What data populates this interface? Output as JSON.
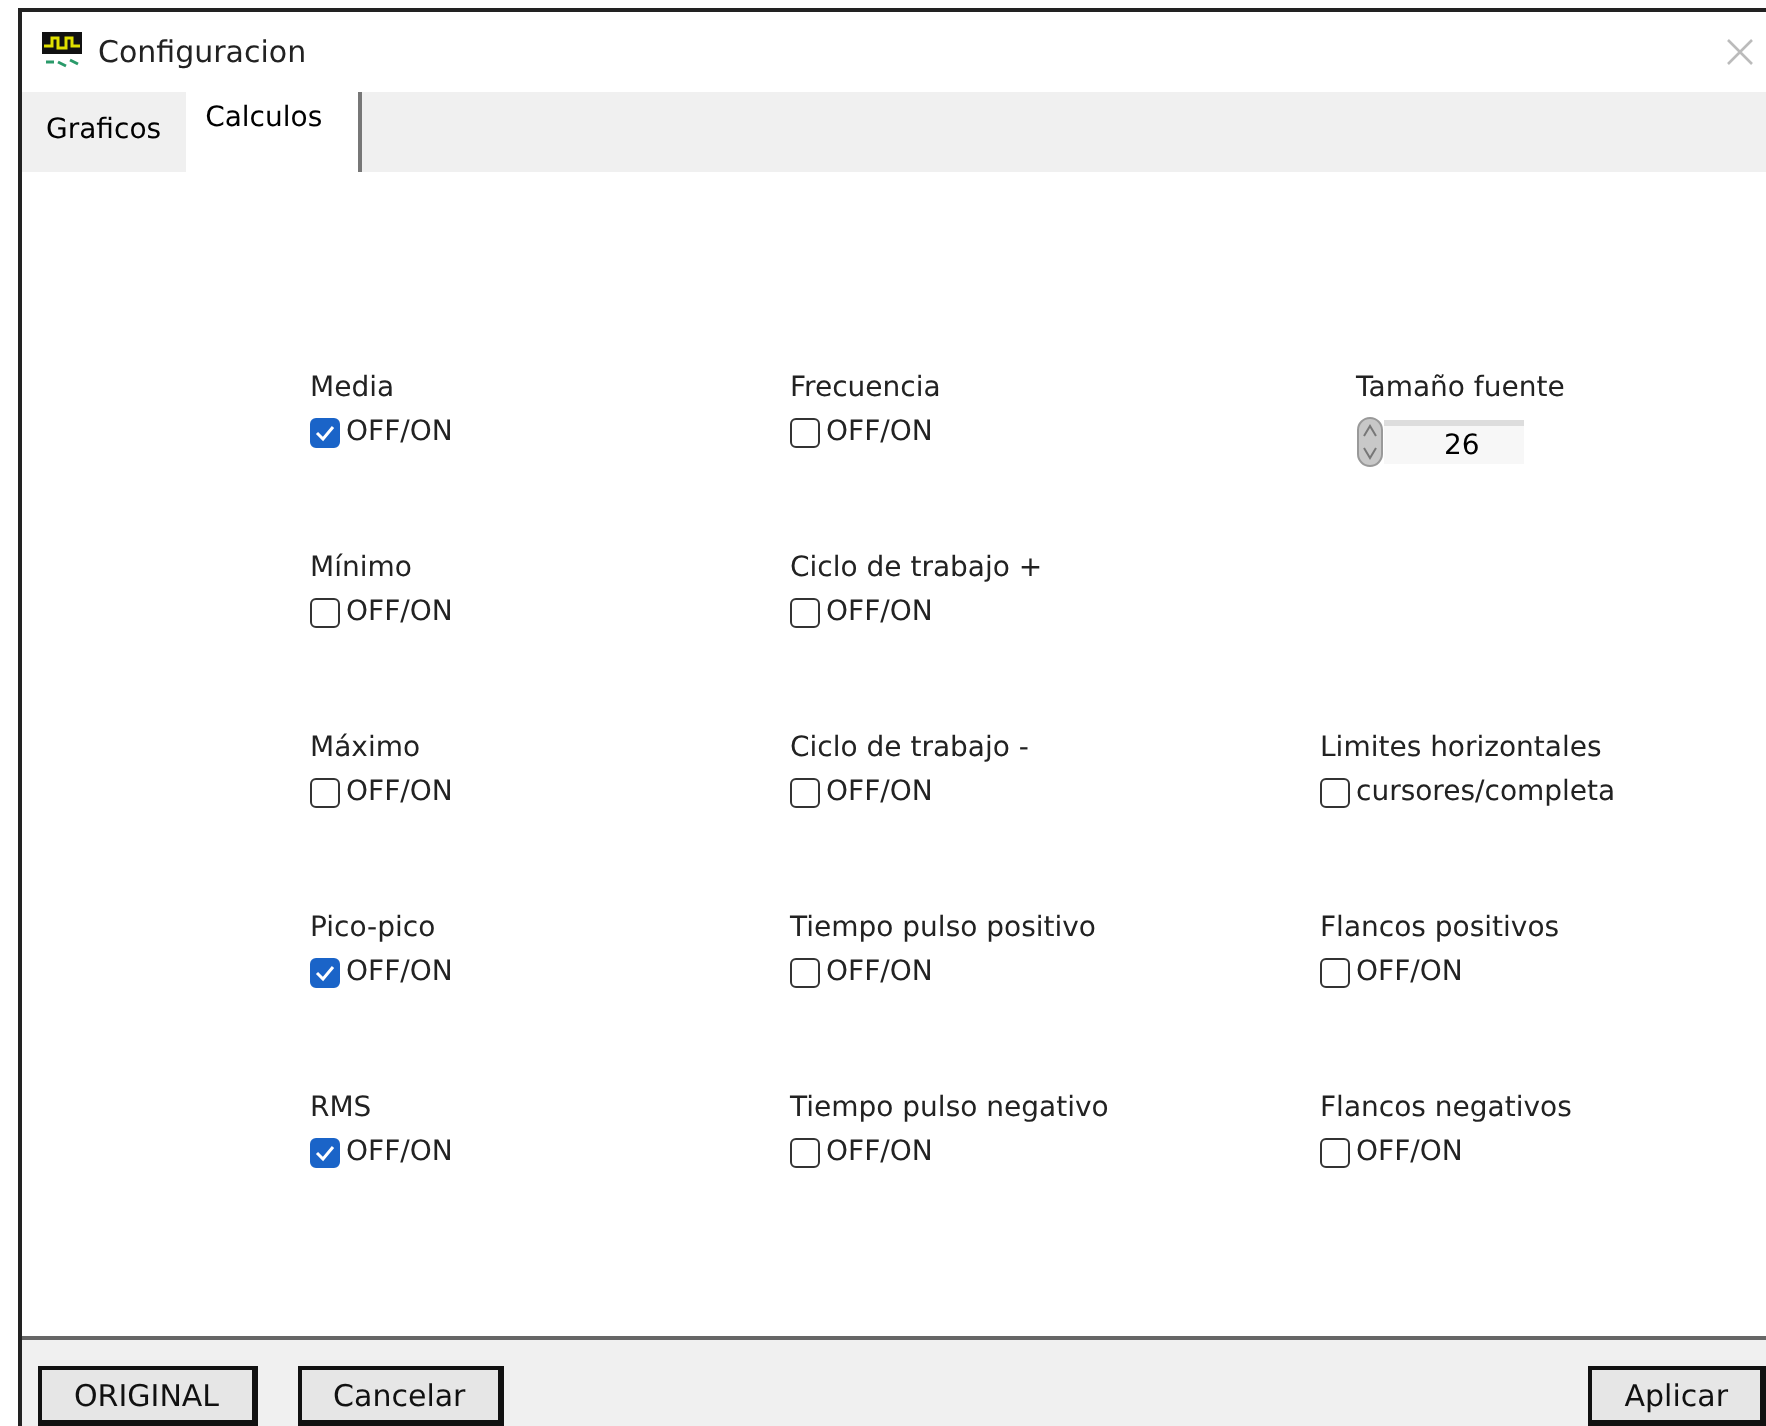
{
  "window": {
    "title": "Configuracion"
  },
  "tabs": [
    {
      "label": "Graficos",
      "selected": false
    },
    {
      "label": "Calculos",
      "selected": true
    }
  ],
  "grid": [
    [
      {
        "kind": "checkbox",
        "label": "Media",
        "option": "OFF/ON",
        "checked": true
      },
      {
        "kind": "checkbox",
        "label": "Frecuencia",
        "option": "OFF/ON",
        "checked": false
      },
      {
        "kind": "spinner",
        "label": "Tamaño fuente",
        "value": "26"
      }
    ],
    [
      {
        "kind": "checkbox",
        "label": "Mínimo",
        "option": "OFF/ON",
        "checked": false
      },
      {
        "kind": "checkbox",
        "label": "Ciclo de trabajo +",
        "option": "OFF/ON",
        "checked": false
      },
      {
        "kind": "empty"
      }
    ],
    [
      {
        "kind": "checkbox",
        "label": "Máximo",
        "option": "OFF/ON",
        "checked": false
      },
      {
        "kind": "checkbox",
        "label": "Ciclo de trabajo -",
        "option": "OFF/ON",
        "checked": false
      },
      {
        "kind": "checkbox",
        "label": "Limites horizontales",
        "option": "cursores/completa",
        "checked": false
      }
    ],
    [
      {
        "kind": "checkbox",
        "label": "Pico-pico",
        "option": "OFF/ON",
        "checked": true
      },
      {
        "kind": "checkbox",
        "label": "Tiempo pulso positivo",
        "option": "OFF/ON",
        "checked": false
      },
      {
        "kind": "checkbox",
        "label": "Flancos positivos",
        "option": "OFF/ON",
        "checked": false
      }
    ],
    [
      {
        "kind": "checkbox",
        "label": "RMS",
        "option": "OFF/ON",
        "checked": true
      },
      {
        "kind": "checkbox",
        "label": "Tiempo pulso negativo",
        "option": "OFF/ON",
        "checked": false
      },
      {
        "kind": "checkbox",
        "label": "Flancos negativos",
        "option": "OFF/ON",
        "checked": false
      }
    ]
  ],
  "buttons_left": [
    "ORIGINAL",
    "Cancelar"
  ],
  "buttons_right": [
    "Aplicar"
  ]
}
